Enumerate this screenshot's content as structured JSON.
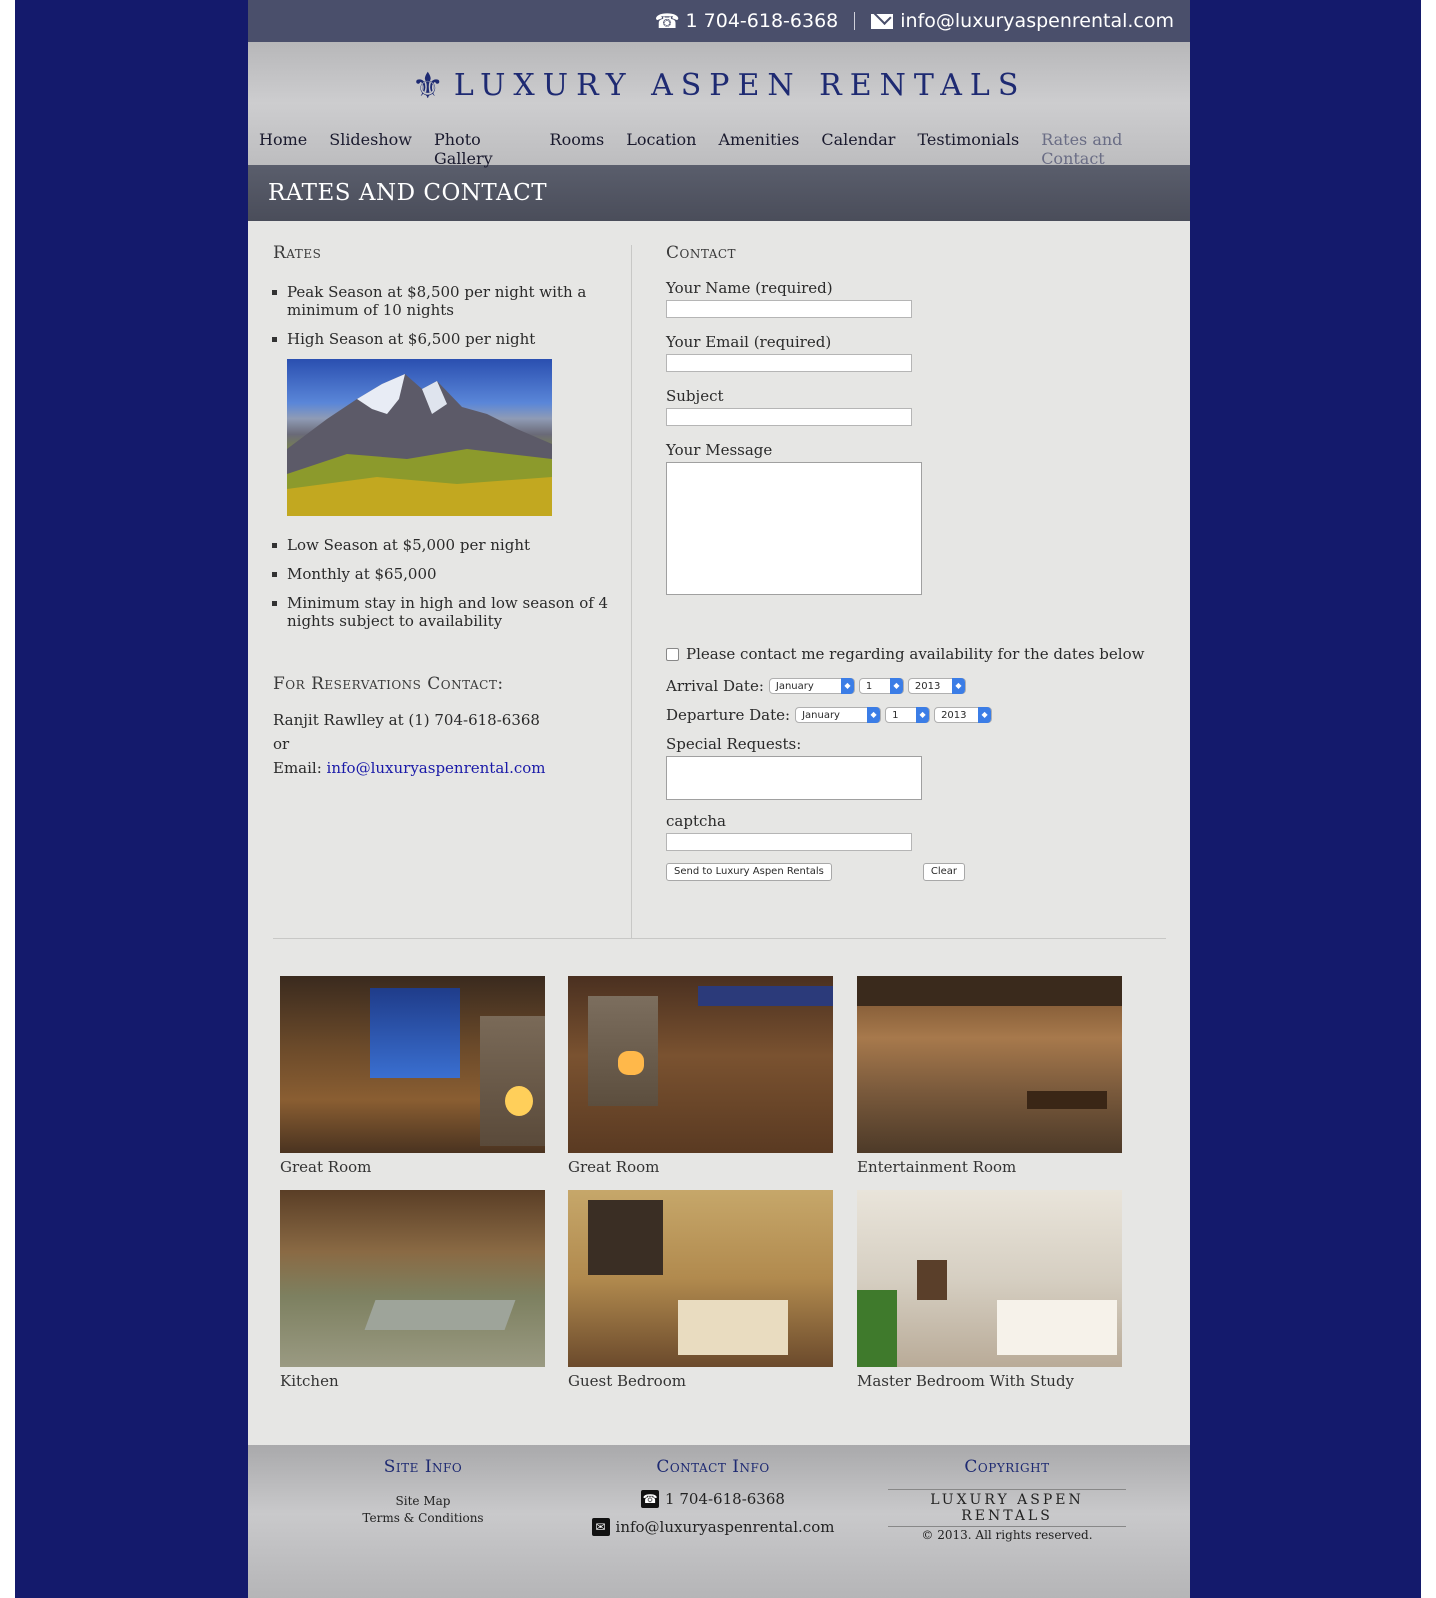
{
  "top_bar": {
    "phone": "1 704-618-6368",
    "email": "info@luxuryaspenrental.com"
  },
  "brand": {
    "name": "LUXURY ASPEN RENTALS"
  },
  "nav": [
    {
      "label": "Home"
    },
    {
      "label": "Slideshow"
    },
    {
      "label": "Photo Gallery"
    },
    {
      "label": "Rooms"
    },
    {
      "label": "Location"
    },
    {
      "label": "Amenities"
    },
    {
      "label": "Calendar"
    },
    {
      "label": "Testimonials"
    },
    {
      "label": "Rates and Contact",
      "active": true
    }
  ],
  "page_title": "RATES AND CONTACT",
  "rates": {
    "heading": "Rates",
    "items": [
      "Peak Season at $8,500 per night with a minimum of 10 nights",
      "High Season at $6,500 per night",
      "Low Season at $5,000 per night",
      "Monthly at $65,000",
      "Minimum stay in high and low season of 4 nights subject to availability"
    ],
    "reservations_heading": "For Reservations Contact:",
    "contact_line": "Ranjit Rawlley at (1) 704-618-6368",
    "or": "or",
    "email_label": "Email:",
    "email_link": "info@luxuryaspenrental.com"
  },
  "contact": {
    "heading": "Contact",
    "name_label": "Your Name (required)",
    "email_label": "Your Email (required)",
    "subject_label": "Subject",
    "message_label": "Your Message",
    "checkbox_label": "Please contact me regarding availability for the dates below",
    "arrival_label": "Arrival Date:",
    "departure_label": "Departure Date:",
    "arrival": {
      "month": "January",
      "day": "1",
      "year": "2013"
    },
    "departure": {
      "month": "January",
      "day": "1",
      "year": "2013"
    },
    "special_label": "Special Requests:",
    "captcha_label": "captcha",
    "send_button": "Send to Luxury Aspen Rentals",
    "clear_button": "Clear"
  },
  "gallery": [
    {
      "caption": "Great Room"
    },
    {
      "caption": "Great Room"
    },
    {
      "caption": "Entertainment Room"
    },
    {
      "caption": "Kitchen"
    },
    {
      "caption": "Guest Bedroom"
    },
    {
      "caption": "Master Bedroom With Study"
    }
  ],
  "footer": {
    "site_info_heading": "Site Info",
    "site_map": "Site Map",
    "terms": "Terms & Conditions",
    "contact_heading": "Contact Info",
    "phone": "1 704-618-6368",
    "email": "info@luxuryaspenrental.com",
    "copyright_heading": "Copyright",
    "copyright_brand": "LUXURY ASPEN RENTALS",
    "copyright_text": "© 2013. All rights reserved."
  },
  "colors": {
    "page_background": "#141a6c",
    "brand_blue": "#1e2a72",
    "title_bar": "#4a4d5a",
    "select_accent": "#3b7de6"
  }
}
